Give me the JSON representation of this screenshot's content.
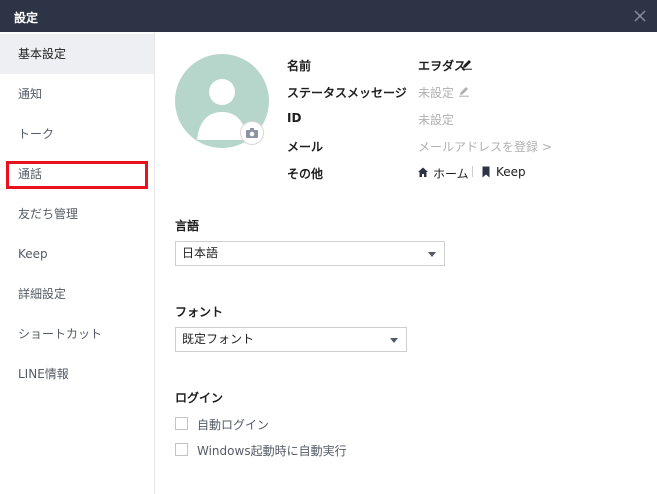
{
  "window": {
    "title": "設定",
    "close_icon": "close-icon"
  },
  "sidebar": {
    "items": [
      {
        "label": "基本設定",
        "active": true
      },
      {
        "label": "通知"
      },
      {
        "label": "トーク"
      },
      {
        "label": "通話",
        "highlighted": true
      },
      {
        "label": "友だち管理"
      },
      {
        "label": "Keep"
      },
      {
        "label": "詳細設定"
      },
      {
        "label": "ショートカット"
      },
      {
        "label": "LINE情報"
      }
    ]
  },
  "profile": {
    "avatar_icon": "default-avatar",
    "camera_icon": "camera-icon",
    "fields": {
      "name": {
        "label": "名前",
        "value": "エヲダス"
      },
      "status": {
        "label": "ステータスメッセージ",
        "value": "未設定"
      },
      "id": {
        "label": "ID",
        "value": "未設定"
      },
      "email": {
        "label": "メール",
        "value": "メールアドレスを登録 >"
      },
      "other": {
        "label": "その他",
        "home_link": "ホーム",
        "keep_link": "Keep"
      }
    }
  },
  "language": {
    "title": "言語",
    "selected": "日本語"
  },
  "font": {
    "title": "フォント",
    "selected": "既定フォント"
  },
  "login": {
    "title": "ログイン",
    "options": [
      {
        "label": "自動ログイン",
        "checked": false
      },
      {
        "label": "Windows起動時に自動実行",
        "checked": false
      }
    ]
  },
  "colors": {
    "titlebar": "#2c3445",
    "sidebar_active": "#eeeff2",
    "highlight": "#e8111e",
    "avatar_bg": "#b7d6cb"
  }
}
